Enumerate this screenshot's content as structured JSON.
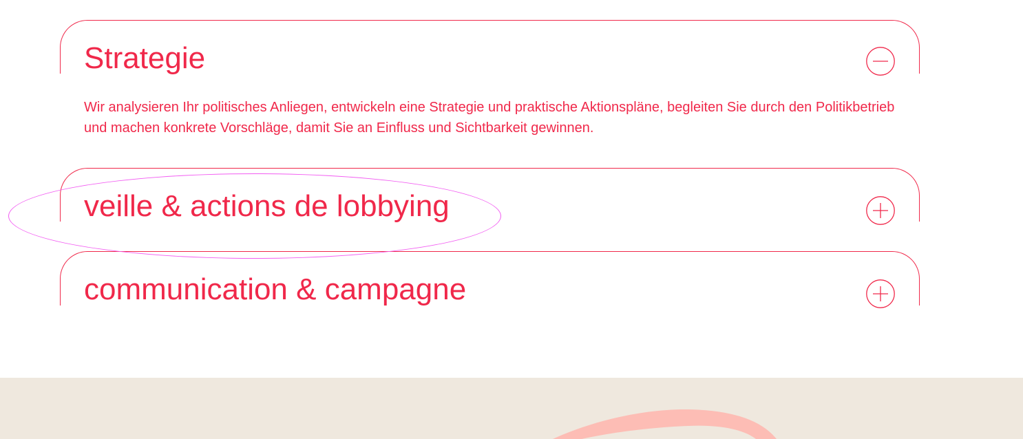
{
  "colors": {
    "accent": "#f0284a",
    "highlight": "#f25cf2",
    "footer_bg": "#efe8de",
    "footer_swoosh": "#fdbdb5"
  },
  "accordion": {
    "items": [
      {
        "title": "Strategie",
        "expanded": true,
        "toggle_icon": "minus-circle-icon",
        "body": "Wir analysieren Ihr politisches Anliegen, entwickeln eine Strategie und praktische Aktionspläne, begleiten Sie durch den Politikbetrieb und machen konkrete Vorschläge, damit Sie an Einfluss und Sichtbarkeit gewinnen."
      },
      {
        "title": "veille & actions de lobbying",
        "expanded": false,
        "toggle_icon": "plus-circle-icon"
      },
      {
        "title": "communication & campagne",
        "expanded": false,
        "toggle_icon": "plus-circle-icon"
      }
    ]
  }
}
